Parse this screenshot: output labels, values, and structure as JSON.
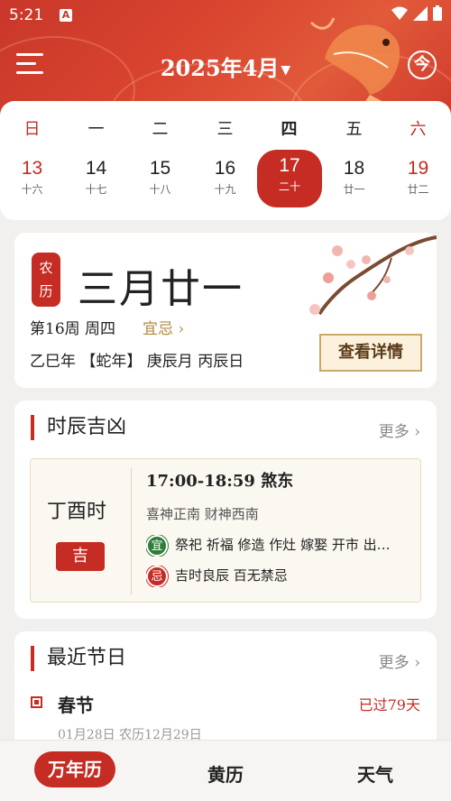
{
  "status": {
    "time": "5:21",
    "notif": "A"
  },
  "header": {
    "month_title": "2025年4月",
    "today_icon": "今"
  },
  "week": {
    "dow": [
      "日",
      "一",
      "二",
      "三",
      "四",
      "五",
      "六"
    ],
    "days": [
      {
        "num": "13",
        "lunar": "十六"
      },
      {
        "num": "14",
        "lunar": "十七"
      },
      {
        "num": "15",
        "lunar": "十八"
      },
      {
        "num": "16",
        "lunar": "十九"
      },
      {
        "num": "17",
        "lunar": "二十"
      },
      {
        "num": "18",
        "lunar": "廿一"
      },
      {
        "num": "19",
        "lunar": "廿二"
      }
    ]
  },
  "lunar_card": {
    "seal_1": "农",
    "seal_2": "历",
    "lunar_date": "三月廿一",
    "week_info": "第16周 周四",
    "yiji": "宜忌",
    "ganzhi": "乙巳年 【蛇年】 庚辰月 丙辰日",
    "detail_button": "查看详情"
  },
  "shichen_card": {
    "title": "时辰吉凶",
    "more": "更多",
    "name": "丁酉时",
    "luck": "吉",
    "time": "17:00-18:59 煞东",
    "gods": "喜神正南 财神西南",
    "yi_badge": "宜",
    "yi_text": "祭祀 祈福 修造 作灶 嫁娶 开市 出…",
    "ji_badge": "忌",
    "ji_text": "吉时良辰 百无禁忌"
  },
  "holiday_card": {
    "title": "最近节日",
    "more": "更多",
    "name": "春节",
    "past": "已过79天",
    "date": "01月28日   农历12月29日"
  },
  "nav": {
    "tab1": "万年历",
    "tab2": "黄历",
    "tab3": "天气"
  },
  "colors": {
    "primary": "#c42c24",
    "gold": "#b38a3e",
    "green": "#2f7d3a"
  }
}
